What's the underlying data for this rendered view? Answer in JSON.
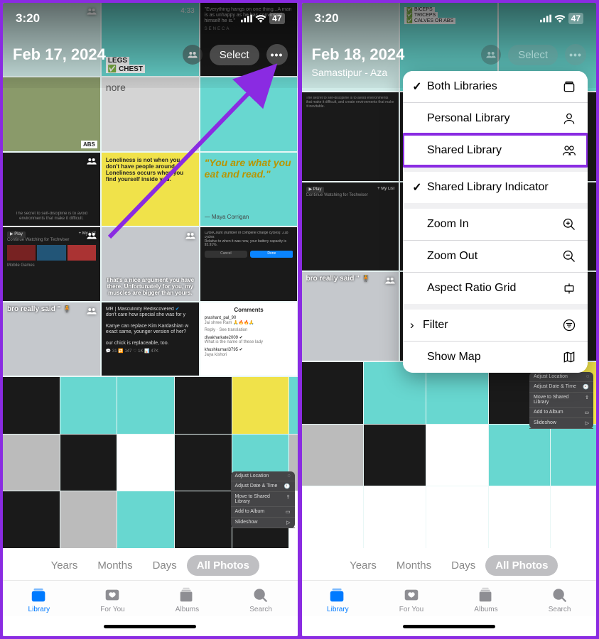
{
  "status": {
    "time": "3:20",
    "battery": "47"
  },
  "left": {
    "date": "Feb 17, 2024",
    "select": "Select"
  },
  "right": {
    "date": "Feb 18, 2024",
    "location": "Samastipur - Aza",
    "select": "Select"
  },
  "segment": {
    "years": "Years",
    "months": "Months",
    "days": "Days",
    "all": "All Photos"
  },
  "tabs": {
    "library": "Library",
    "foryou": "For You",
    "albums": "Albums",
    "search": "Search"
  },
  "menu": {
    "both": "Both Libraries",
    "personal": "Personal Library",
    "shared": "Shared Library",
    "indicator": "Shared Library Indicator",
    "zoomin": "Zoom In",
    "zoomout": "Zoom Out",
    "aspect": "Aspect Ratio Grid",
    "filter": "Filter",
    "showmap": "Show Map"
  },
  "mini_menu": {
    "loc": "Adjust Location",
    "date": "Adjust Date & Time",
    "move": "Move to Shared Library",
    "add": "Add to Album",
    "slide": "Slideshow"
  },
  "thumbs": {
    "quote_eat": "\"You are what you eat and read.\"",
    "quote_eat_by": "— Maya Corrigan",
    "quote_lonely": "Loneliness is not when you don't have people around. Loneliness occurs when you find yourself inside you.",
    "quote_seneca": "\"Everything hangs on one thing...A man is as unhappy as he has convinced himself he is.\"",
    "seneca": "SENECA",
    "argument": "That's a nice argument you have there. Unfortunately for you, my muscles are bigger than yours.",
    "bro": "bro really said \" 🧍",
    "duration": "4:33",
    "more": "nore",
    "legs": "LEGS",
    "chest": "CHEST",
    "abs": "ABS",
    "biceps": "BICEPS",
    "triceps": "TRICEPS",
    "calves": "CALVES OR ABS",
    "continue": "Continue Watching for Techwiser",
    "mobile": "Mobile Games",
    "comments": "Comments",
    "masculinity": "MR | Masculinity Rediscovered",
    "care": "don't care how special she was for y",
    "kanye": "Kanye can replace Kim Kardashian w exact same, younger version of her?",
    "chick": "our chick is replaceable, too.",
    "play": "▶ Play",
    "mylist": "+ My List"
  }
}
